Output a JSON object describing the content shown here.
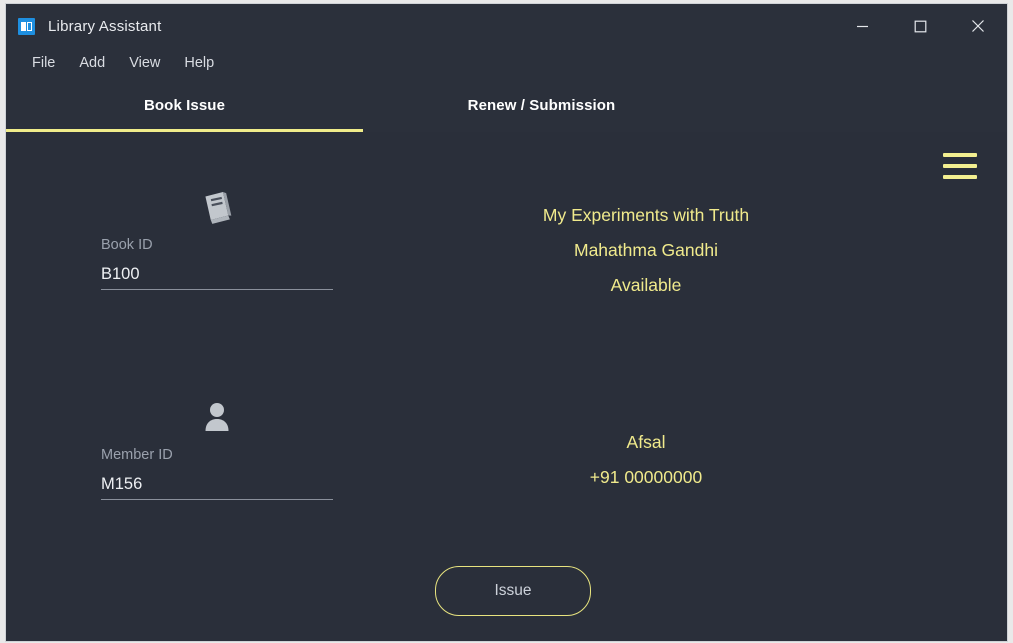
{
  "window": {
    "title": "Library Assistant",
    "app_icon": "library-app-icon",
    "controls": {
      "minimize": "minimize-icon",
      "maximize": "maximize-icon",
      "close": "close-icon"
    }
  },
  "menubar": {
    "items": [
      {
        "label": "File"
      },
      {
        "label": "Add"
      },
      {
        "label": "View"
      },
      {
        "label": "Help"
      }
    ]
  },
  "tabs": [
    {
      "label": "Book Issue",
      "active": true
    },
    {
      "label": "Renew / Submission",
      "active": false
    }
  ],
  "toolbar": {
    "menu_icon": "hamburger-menu-icon"
  },
  "form": {
    "book": {
      "icon": "book-icon",
      "label": "Book ID",
      "value": "B100"
    },
    "member": {
      "icon": "person-icon",
      "label": "Member ID",
      "value": "M156"
    }
  },
  "book_details": {
    "title": "My Experiments with Truth",
    "author": "Mahathma Gandhi",
    "status": "Available"
  },
  "member_details": {
    "name": "Afsal",
    "phone": "+91 00000000"
  },
  "actions": {
    "issue_label": "Issue"
  },
  "colors": {
    "accent_yellow": "#f0ec8a",
    "window_bg": "#2a2f3a",
    "chrome_bg": "#2b303b",
    "label_grey": "#9aa1ad",
    "icon_grey": "#c2c7cd",
    "app_icon_blue": "#1e8fe0"
  }
}
